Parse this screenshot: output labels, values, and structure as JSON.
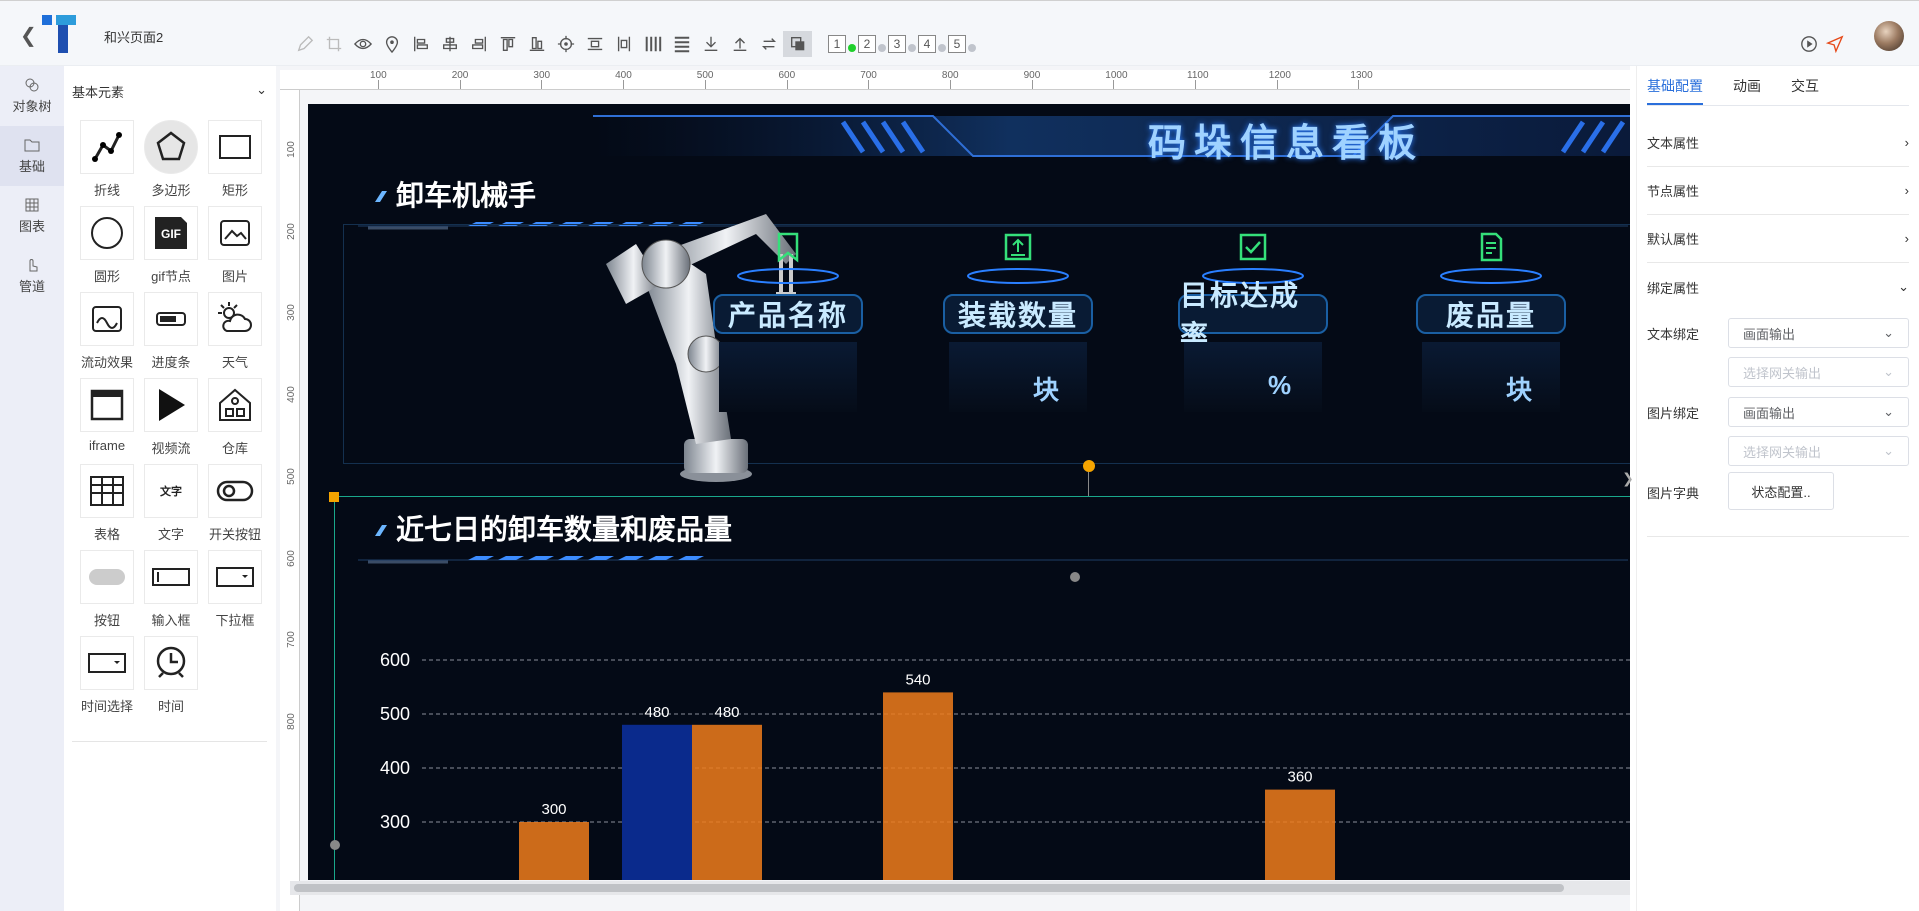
{
  "app": {
    "page_name": "和兴页面2"
  },
  "toolbar": {
    "pages": [
      "1",
      "2",
      "3",
      "4",
      "5"
    ]
  },
  "rail": {
    "items": [
      {
        "label": "对象树",
        "icon": "object-tree-icon"
      },
      {
        "label": "基础",
        "icon": "folder-icon"
      },
      {
        "label": "图表",
        "icon": "table-chart-icon"
      },
      {
        "label": "管道",
        "icon": "pipe-hand-icon"
      }
    ]
  },
  "palette": {
    "header": "基本元素",
    "items": [
      {
        "label": "折线",
        "icon": "polyline-icon"
      },
      {
        "label": "多边形",
        "icon": "polygon-icon"
      },
      {
        "label": "矩形",
        "icon": "rectangle-icon"
      },
      {
        "label": "圆形",
        "icon": "circle-icon"
      },
      {
        "label": "gif节点",
        "icon": "gif-icon"
      },
      {
        "label": "图片",
        "icon": "image-icon"
      },
      {
        "label": "流动效果",
        "icon": "flow-effect-icon"
      },
      {
        "label": "进度条",
        "icon": "progress-bar-icon"
      },
      {
        "label": "天气",
        "icon": "weather-icon"
      },
      {
        "label": "iframe",
        "icon": "iframe-icon"
      },
      {
        "label": "视频流",
        "icon": "video-play-icon"
      },
      {
        "label": "仓库",
        "icon": "warehouse-icon"
      },
      {
        "label": "表格",
        "icon": "table-icon"
      },
      {
        "label": "文字",
        "icon": "text-icon"
      },
      {
        "label": "开关按钮",
        "icon": "toggle-switch-icon"
      },
      {
        "label": "按钮",
        "icon": "button-icon"
      },
      {
        "label": "输入框",
        "icon": "input-box-icon"
      },
      {
        "label": "下拉框",
        "icon": "dropdown-box-icon"
      },
      {
        "label": "时间选择",
        "icon": "time-picker-icon"
      },
      {
        "label": "时间",
        "icon": "clock-icon"
      }
    ],
    "text_icon_label": "文字",
    "gif_text": "GIF"
  },
  "ruler": {
    "h": [
      "100",
      "200",
      "300",
      "400",
      "500",
      "600",
      "700",
      "800",
      "900",
      "1000",
      "1100",
      "1200",
      "1300"
    ],
    "v": [
      "100",
      "200",
      "300",
      "400",
      "500",
      "600",
      "700",
      "800"
    ]
  },
  "dashboard": {
    "title": "码垛信息看板",
    "section1": "卸车机械手",
    "section2": "近七日的卸车数量和废品量",
    "kpis": [
      {
        "name": "产品名称",
        "unit": "",
        "icon": "bookmark-icon"
      },
      {
        "name": "装载数量",
        "unit": "块",
        "icon": "upload-box-icon"
      },
      {
        "name": "目标达成率",
        "unit": "%",
        "icon": "checkbox-icon"
      },
      {
        "name": "废品量",
        "unit": "块",
        "icon": "document-icon"
      }
    ]
  },
  "chart_data": {
    "type": "bar",
    "y_ticks": [
      "600",
      "500",
      "400",
      "300"
    ],
    "grid": true,
    "bars": [
      {
        "value": 300,
        "label": "300",
        "color": "#f07d1b"
      },
      {
        "value": 480,
        "label": "480",
        "color": "#0a2a8c"
      },
      {
        "value": 480,
        "label": "480",
        "color": "#f07d1b"
      },
      {
        "value": 540,
        "label": "540",
        "color": "#f07d1b"
      },
      {
        "value": 360,
        "label": "360",
        "color": "#f07d1b"
      }
    ]
  },
  "right_panel": {
    "tabs": [
      "基础配置",
      "动画",
      "交互"
    ],
    "active_tab": "基础配置",
    "sections": [
      "文本属性",
      "节点属性",
      "默认属性",
      "绑定属性"
    ],
    "text_binding": {
      "label": "文本绑定",
      "value": "画面输出",
      "placeholder": "选择网关输出"
    },
    "image_binding": {
      "label": "图片绑定",
      "value": "画面输出",
      "placeholder": "选择网关输出"
    },
    "image_dict": {
      "label": "图片字典",
      "button": "状态配置.."
    }
  },
  "colors": {
    "accent": "#2a6fdb",
    "dashboard_bg": "#040a16",
    "bar_orange": "#f07d1b",
    "bar_blue": "#0a2a8c",
    "kpi_icon": "#35e07a"
  }
}
